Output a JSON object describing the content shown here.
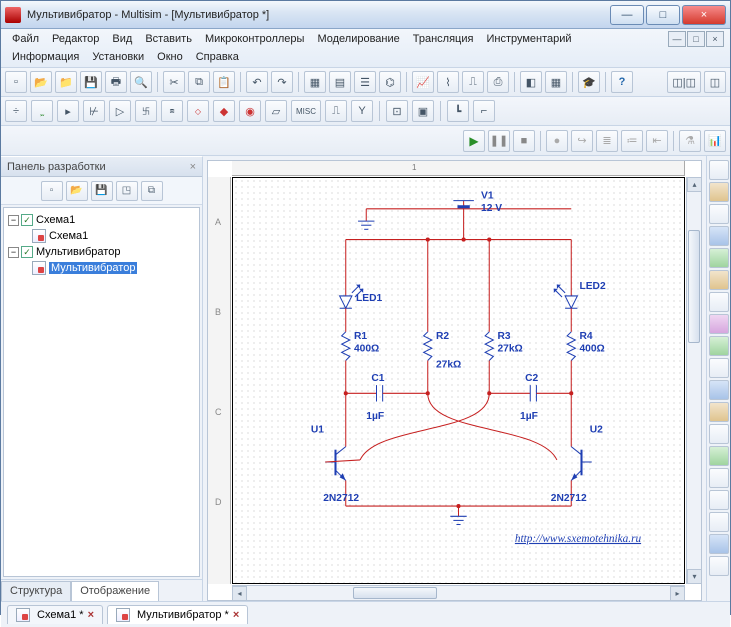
{
  "window": {
    "title": "Мультивибратор - Multisim - [Мультивибратор *]",
    "min": "—",
    "max": "□",
    "close": "×"
  },
  "menu": {
    "row1": [
      "Файл",
      "Редактор",
      "Вид",
      "Вставить",
      "Микроконтроллеры",
      "Моделирование",
      "Трансляция",
      "Инструментарий"
    ],
    "row2": [
      "Информация",
      "Установки",
      "Окно",
      "Справка"
    ]
  },
  "sidebar": {
    "title": "Панель разработки",
    "close": "×",
    "items": [
      {
        "type": "root",
        "label": "Схема1",
        "checked": true
      },
      {
        "type": "child",
        "label": "Схема1"
      },
      {
        "type": "root",
        "label": "Мультивибратор",
        "checked": true
      },
      {
        "type": "child",
        "label": "Мультивибратор",
        "selected": true
      }
    ],
    "tabs": [
      "Структура",
      "Отображение"
    ],
    "active_tab": 1
  },
  "circuit": {
    "V1": {
      "name": "V1",
      "val": "12 V"
    },
    "LED1": "LED1",
    "LED2": "LED2",
    "R1": {
      "name": "R1",
      "val": "400Ω"
    },
    "R2": {
      "name": "R2",
      "val": "27kΩ"
    },
    "R3": {
      "name": "R3",
      "val": "27kΩ"
    },
    "R4": {
      "name": "R4",
      "val": "400Ω"
    },
    "C1": {
      "name": "C1",
      "val": "1µF"
    },
    "C2": {
      "name": "C2",
      "val": "1µF"
    },
    "U1": "U1",
    "U2": "U2",
    "Q": "2N2712",
    "link": "http://www.sxemotehnika.ru"
  },
  "doc_tabs": [
    {
      "label": "Схема1 *",
      "active": false
    },
    {
      "label": "Мультивибратор *",
      "active": true
    }
  ],
  "ruler_v": [
    "A",
    "B",
    "C",
    "D"
  ]
}
